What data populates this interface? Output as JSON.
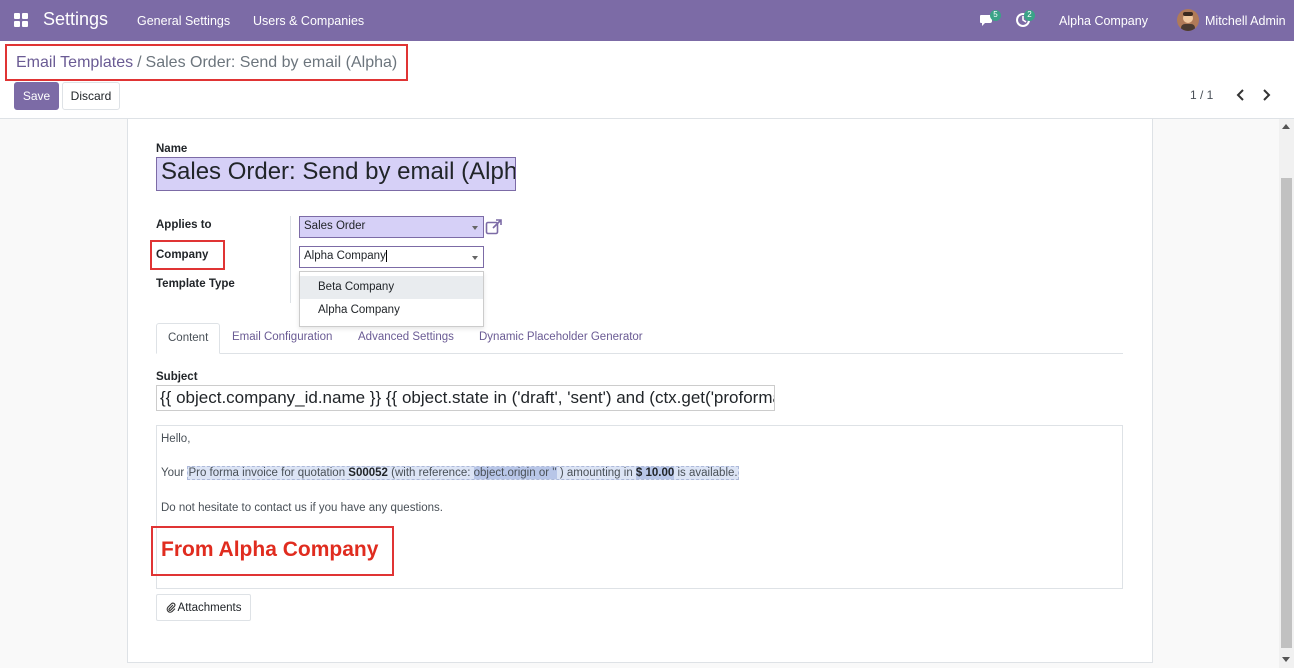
{
  "navbar": {
    "app_name": "Settings",
    "menu": [
      "General Settings",
      "Users & Companies"
    ],
    "messages_badge": "5",
    "activities_badge": "2",
    "company": "Alpha Company",
    "user": "Mitchell Admin",
    "color": "#7c6ba6"
  },
  "breadcrumb": {
    "parent": "Email Templates",
    "separator": "/",
    "current": "Sales Order: Send by email (Alpha)"
  },
  "toolbar": {
    "save_label": "Save",
    "discard_label": "Discard",
    "pager": "1 / 1"
  },
  "form": {
    "name_label": "Name",
    "name_value": "Sales Order: Send by email (Alpha)",
    "applies_to_label": "Applies to",
    "applies_to_value": "Sales Order",
    "company_label": "Company",
    "company_value": "Alpha Company",
    "template_type_label": "Template Type",
    "company_options": [
      "Beta Company",
      "Alpha Company"
    ],
    "tabs": [
      "Content",
      "Email Configuration",
      "Advanced Settings",
      "Dynamic Placeholder Generator"
    ],
    "subject_label": "Subject",
    "subject_value": "{{ object.company_id.name }} {{ object.state in ('draft', 'sent') and (ctx.get('proforma') and 'Proforma' or 'Quotation') or 'Order' }}",
    "body": {
      "greeting": "Hello,",
      "line_prefix": "Your",
      "ph_1": "Pro forma invoice for",
      "ph_2": "quotation",
      "ph_3": "S00052",
      "ph_4": "(with reference:",
      "ph_5": "object.origin or ''",
      "ph_6": ") amounting in",
      "ph_7": "$ 10.00",
      "ph_8": "is available.",
      "closing": "Do not hesitate to contact us if you have any questions.",
      "signature": "From Alpha Company"
    },
    "attachments_label": "Attachments"
  },
  "colors": {
    "accent": "#7c6ba6",
    "highlight_red": "#e03434",
    "signature_red": "#e02c1f"
  }
}
